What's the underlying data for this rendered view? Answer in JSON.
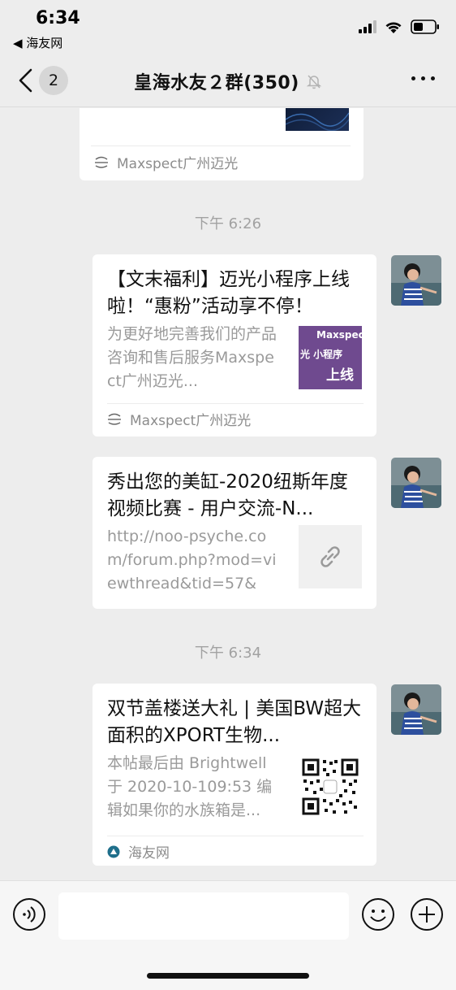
{
  "status_bar": {
    "time": "6:34",
    "back_app": "◀ 海友网"
  },
  "nav": {
    "unread_count": "2",
    "title": "皇海水友２群(350)",
    "icons": [
      "back-chevron-icon",
      "mute-bell-icon",
      "more-icon"
    ]
  },
  "messages": [
    {
      "type": "article-partial",
      "source": "Maxspect广州迈光"
    },
    {
      "type": "timestamp",
      "text": "下午 6:26"
    },
    {
      "type": "article",
      "title": "【文末福利】迈光小程序上线啦！“惠粉”活动享不停！",
      "desc": "为更好地完善我们的产品咨询和售后服务Maxspect广州迈光...",
      "thumb_lines": [
        "Maxspec",
        "光 小程序",
        "上线"
      ],
      "source": "Maxspect广州迈光"
    },
    {
      "type": "link",
      "title": "秀出您的美缸-2020纽斯年度视频比赛 - 用户交流-N...",
      "desc": "http://noo-psyche.com/forum.php?mod=viewthread&tid=57&m..."
    },
    {
      "type": "timestamp",
      "text": "下午 6:34"
    },
    {
      "type": "article",
      "title": "双节盖楼送大礼 | 美国BW超大面积的XPORT生物...",
      "desc": "本帖最后由 Brightwell 于 2020-10-109:53 编辑如果你的水族箱是...",
      "source": "海友网"
    }
  ],
  "colors": {
    "background": "#ededed",
    "card": "#ffffff",
    "timestamp": "#a2a2a2",
    "desc": "#9a9a9a",
    "thumb_purple": "#6f4a8f"
  }
}
